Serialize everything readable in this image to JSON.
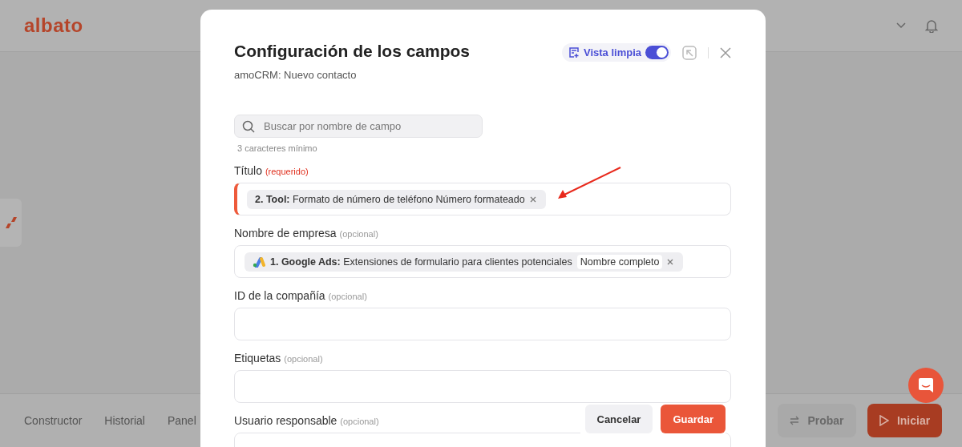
{
  "header": {
    "logo": "albato"
  },
  "bottom_bar": {
    "tabs": [
      {
        "label": "Constructor"
      },
      {
        "label": "Historial"
      },
      {
        "label": "Panel"
      }
    ],
    "buttons": [
      {
        "label": "Probar",
        "kind": "secondary"
      },
      {
        "label": "Iniciar",
        "kind": "primary"
      }
    ]
  },
  "modal": {
    "title": "Configuración de los campos",
    "subtitle": "amoCRM: Nuevo contacto",
    "clean_view": {
      "label": "Vista limpia",
      "on": true
    },
    "search": {
      "placeholder": "Buscar por nombre de campo"
    },
    "search_hint": "3 caracteres mínimo",
    "fields": [
      {
        "label": "Título",
        "tag": "(requerido)",
        "required": true,
        "chips": [
          {
            "kind": "plain",
            "source": "2. Tool:",
            "text": "Formato de número de teléfono Número formateado"
          }
        ]
      },
      {
        "label": "Nombre de empresa",
        "tag": "(opcional)",
        "required": false,
        "chips": [
          {
            "kind": "app",
            "source": "1. Google Ads:",
            "text": "Extensiones de formulario para clientes potenciales",
            "value": "Nombre completo"
          }
        ]
      },
      {
        "label": "ID de la compañía",
        "tag": "(opcional)",
        "required": false
      },
      {
        "label": "Etiquetas",
        "tag": "(opcional)",
        "required": false
      },
      {
        "label": "Usuario responsable",
        "tag": "(opcional)",
        "required": false
      }
    ],
    "buttons": [
      {
        "label": "Cancelar",
        "kind": "secondary"
      },
      {
        "label": "Guardar",
        "kind": "primary"
      }
    ]
  }
}
